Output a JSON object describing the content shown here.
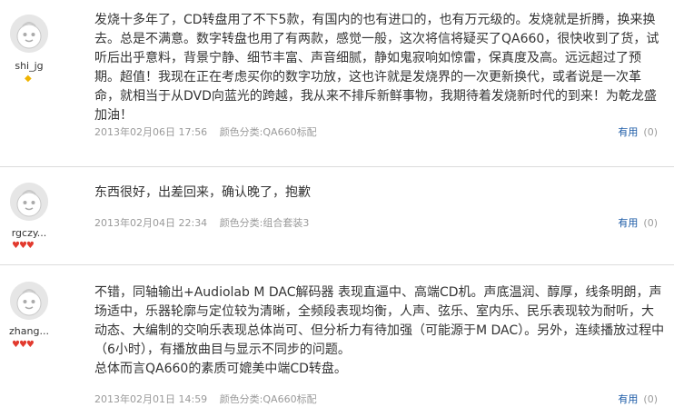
{
  "reviews": [
    {
      "username": "shi_jg",
      "badge": "◆",
      "text": "发烧十多年了，CD转盘用了不下5款，有国内的也有进口的，也有万元级的。发烧就是折腾，换来换去。总是不满意。数字转盘也用了有两款，感觉一般，这次将信将疑买了QA660，很快收到了货，试听后出乎意料，背景宁静、细节丰富、声音细腻，静如鬼寂响如惊雷，保真度及高。远远超过了预期。超值！我现在正在考虑买你的数字功放，这也许就是发烧界的一次更新换代，或者说是一次革命，就相当于从DVD向蓝光的跨越，我从来不排斥新鲜事物，我期待着发烧新时代的到来！为乾龙盛加油！",
      "date": "2013年02月06日 17:56",
      "color": "颜色分类:QA660标配",
      "useful_label": "有用",
      "useful_count": "(0)"
    },
    {
      "username": "rgczy...",
      "badge": "♥♥♥",
      "text": "东西很好，出差回来，确认晚了，抱歉",
      "date": "2013年02月04日 22:34",
      "color": "颜色分类:组合套装3",
      "useful_label": "有用",
      "useful_count": "(0)"
    },
    {
      "username": "zhang...",
      "badge": "♥♥♥",
      "text_lines": [
        "不错，同轴输出+Audiolab M DAC解码器 表现直逼中、高端CD机。声底温润、醇厚，线条明朗，声场适中，乐器轮廓与定位较为清晰，全频段表现均衡，人声、弦乐、室内乐、民乐表现较为耐听，大动态、大编制的交响乐表现总体尚可、但分析力有待加强（可能源于M DAC）。另外，连续播放过程中（6小时），有播放曲目与显示不同步的问题。",
        "总体而言QA660的素质可媲美中端CD转盘。"
      ],
      "date": "2013年02月01日 14:59",
      "color": "颜色分类:QA660标配",
      "useful_label": "有用",
      "useful_count": "(0)"
    }
  ]
}
